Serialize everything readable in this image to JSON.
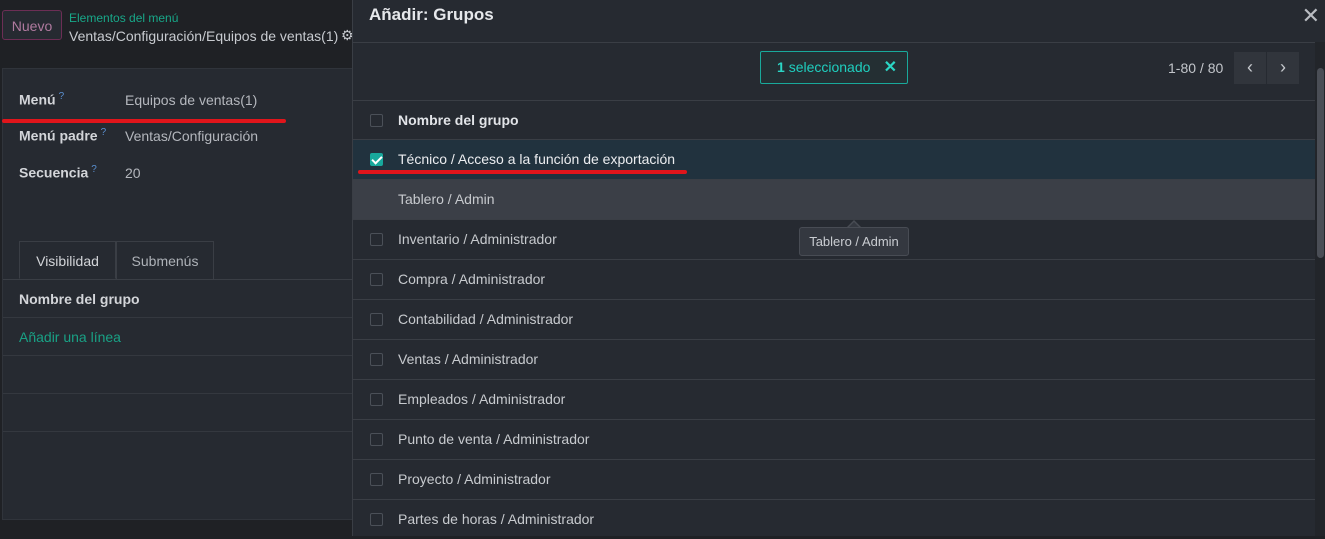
{
  "form": {
    "new_button": "Nuevo",
    "breadcrumb_parent": "Elementos del menú",
    "breadcrumb_current": "Ventas/Configuración/Equipos de ventas(1)",
    "fields": {
      "menu_label": "Menú",
      "menu_value": "Equipos de ventas(1)",
      "parent_label": "Menú padre",
      "parent_value": "Ventas/Configuración",
      "sequence_label": "Secuencia",
      "sequence_value": "20",
      "help_marker": "?"
    },
    "tabs": [
      "Visibilidad",
      "Submenús"
    ],
    "subtable_header": "Nombre del grupo",
    "add_line": "Añadir una línea"
  },
  "dialog": {
    "title": "Añadir: Grupos",
    "selection": {
      "count": "1",
      "label": "seleccionado"
    },
    "pager": {
      "value": "1-80 / 80"
    },
    "column_header": "Nombre del grupo",
    "rows": [
      {
        "label": "Técnico / Acceso a la función de exportación",
        "checked": true
      },
      {
        "label": "Tablero / Admin",
        "checked": false,
        "hovered": true
      },
      {
        "label": "Inventario / Administrador",
        "checked": false
      },
      {
        "label": "Compra / Administrador",
        "checked": false
      },
      {
        "label": "Contabilidad / Administrador",
        "checked": false
      },
      {
        "label": "Ventas / Administrador",
        "checked": false
      },
      {
        "label": "Empleados / Administrador",
        "checked": false
      },
      {
        "label": "Punto de venta / Administrador",
        "checked": false
      },
      {
        "label": "Proyecto / Administrador",
        "checked": false
      },
      {
        "label": "Partes de horas / Administrador",
        "checked": false
      }
    ],
    "tooltip": "Tablero / Admin"
  },
  "colors": {
    "accent": "#18a89c",
    "link": "#19a185",
    "annotation": "#e0151b"
  }
}
